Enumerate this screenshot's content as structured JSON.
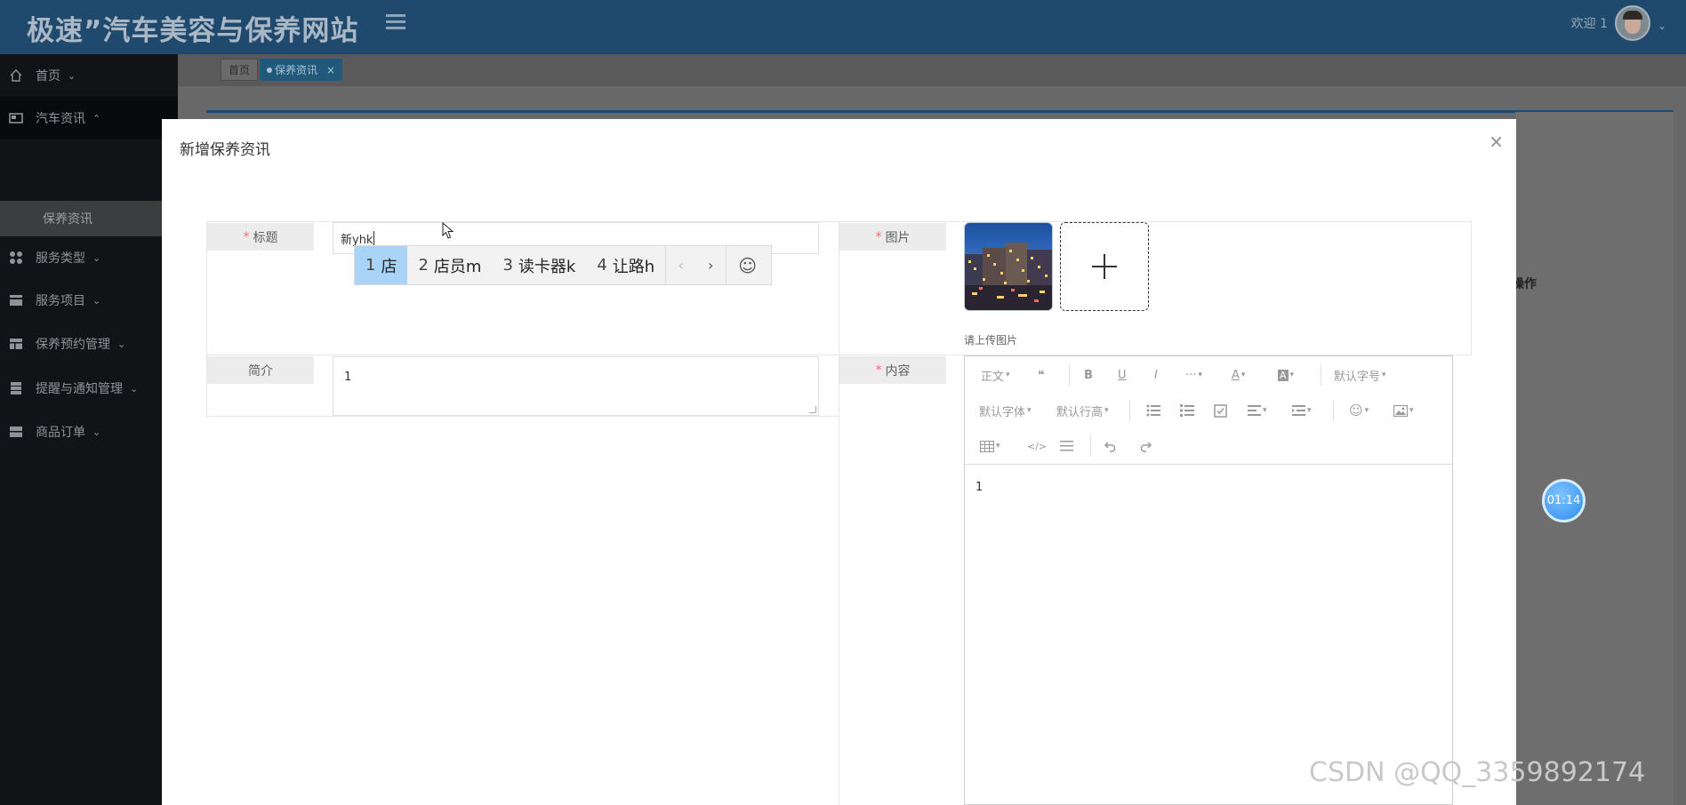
{
  "app": {
    "site_title": "极速”汽车美容与保养网站",
    "welcome_text": "欢迎 1"
  },
  "sidebar": {
    "items": [
      {
        "label": "首页",
        "icon": "home-icon"
      },
      {
        "label": "汽车资讯",
        "icon": "news-icon",
        "expanded": true
      },
      {
        "label": "服务类型",
        "icon": "grid-icon"
      },
      {
        "label": "服务项目",
        "icon": "card-icon"
      },
      {
        "label": "保养预约管理",
        "icon": "table-icon"
      },
      {
        "label": "提醒与通知管理",
        "icon": "server-icon"
      },
      {
        "label": "商品订单",
        "icon": "list-icon"
      }
    ],
    "submenu": {
      "label": "保养资讯",
      "active": true
    }
  },
  "tabs": {
    "home": "首页",
    "active": "保养资讯",
    "close": "×"
  },
  "background": {
    "column_op": "操作"
  },
  "modal": {
    "title": "新增保养资讯",
    "close_symbol": "×",
    "fields": {
      "title_label": "标题",
      "title_value": "新yhk",
      "image_label": "图片",
      "image_tip": "请上传图片",
      "intro_label": "简介",
      "intro_value": "1",
      "content_label": "内容",
      "content_value": "1"
    },
    "required_mark": "*"
  },
  "ime": {
    "candidates": [
      {
        "num": "1",
        "text": "店"
      },
      {
        "num": "2",
        "text": "店员m"
      },
      {
        "num": "3",
        "text": "读卡器k"
      },
      {
        "num": "4",
        "text": "让路h"
      }
    ],
    "prev": "‹",
    "next": "›",
    "emoji": "☺"
  },
  "editor_toolbar": {
    "paragraph": "正文",
    "font_size": "默认字号",
    "font_family": "默认字体",
    "line_height": "默认行高",
    "quote": "❝",
    "bold": "B",
    "underline": "U",
    "italic": "I",
    "more": "···",
    "font_color": "A",
    "bg_color": "A"
  },
  "timer": {
    "value": "01:14"
  },
  "watermark": "CSDN @QQ_3359892174",
  "colors": {
    "topbar": "#1f4a6e",
    "sidebar": "#111417",
    "active_tab": "#1f5a7d",
    "required": "#f56c6c",
    "ime_selected": "#a9d3f7",
    "timer": "#2d8cf0"
  }
}
